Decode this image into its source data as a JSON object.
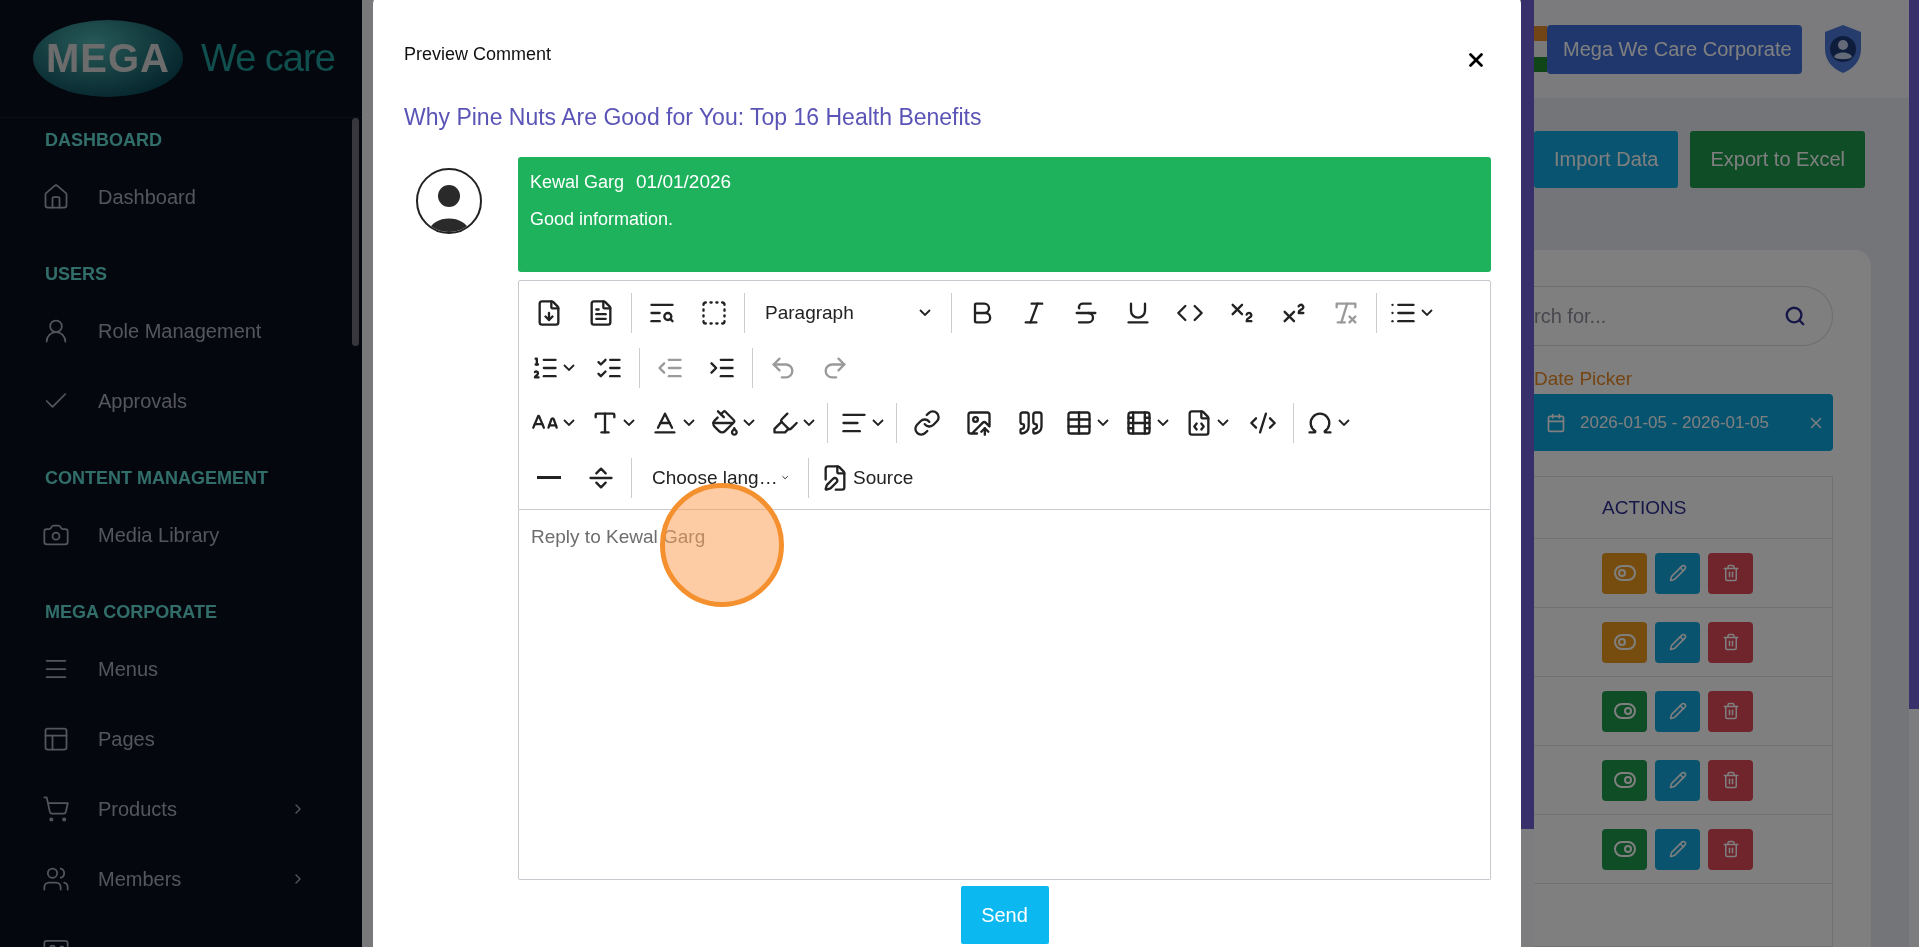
{
  "sidebar": {
    "logo": {
      "badge": "MEGA",
      "text": "We care"
    },
    "sections": [
      {
        "heading": "DASHBOARD",
        "items": [
          {
            "kind": "home",
            "label": "Dashboard",
            "expandable": false
          }
        ]
      },
      {
        "heading": "USERS",
        "items": [
          {
            "kind": "user",
            "label": "Role Management",
            "expandable": false
          },
          {
            "kind": "check",
            "label": "Approvals",
            "expandable": false
          }
        ]
      },
      {
        "heading": "CONTENT MANAGEMENT",
        "items": [
          {
            "kind": "camera",
            "label": "Media Library",
            "expandable": false
          }
        ]
      },
      {
        "heading": "MEGA CORPORATE",
        "items": [
          {
            "kind": "menu",
            "label": "Menus",
            "expandable": false
          },
          {
            "kind": "layout",
            "label": "Pages",
            "expandable": false
          },
          {
            "kind": "cart",
            "label": "Products",
            "expandable": true
          },
          {
            "kind": "users",
            "label": "Members",
            "expandable": true
          },
          {
            "kind": "card",
            "expandable": false
          }
        ]
      }
    ]
  },
  "header": {
    "company": "Mega We Care Corporate"
  },
  "page_buttons": [
    {
      "kind": "import",
      "label": "Import Data"
    },
    {
      "kind": "export",
      "label": "Export to Excel"
    }
  ],
  "search": {
    "placeholder": "rch for..."
  },
  "date_filter": {
    "label": "Date Picker",
    "range": "2026-01-05 - 2026-01-05"
  },
  "table": {
    "columns": [
      "ACTIONS"
    ],
    "rows": [
      {
        "active": false
      },
      {
        "active": false
      },
      {
        "active": true
      },
      {
        "active": true
      },
      {
        "active": true
      }
    ]
  },
  "modal": {
    "title": "Preview Comment",
    "post_title": "Why Pine Nuts Are Good for You: Top 16 Health Benefits",
    "comment": {
      "author": "Kewal Garg",
      "date": "01/01/2026",
      "text": "Good information."
    },
    "editor": {
      "rows": [
        {
          "items": [
            {
              "kind": "pdf",
              "disabled": false,
              "caret": false
            },
            {
              "kind": "word",
              "disabled": false,
              "caret": false
            },
            {
              "kind": "separator"
            },
            {
              "kind": "find",
              "disabled": false,
              "caret": false
            },
            {
              "kind": "selectall",
              "disabled": false,
              "caret": false
            },
            {
              "kind": "separator"
            },
            {
              "kind": "heading",
              "label": "Paragraph",
              "disabled": false,
              "caret": true
            },
            {
              "kind": "separator"
            },
            {
              "kind": "bold",
              "disabled": false,
              "caret": false
            },
            {
              "kind": "italic",
              "disabled": false,
              "caret": false
            },
            {
              "kind": "strike",
              "disabled": false,
              "caret": false
            },
            {
              "kind": "underline",
              "disabled": false,
              "caret": false
            },
            {
              "kind": "code",
              "disabled": false,
              "caret": false
            },
            {
              "kind": "subscript",
              "disabled": false,
              "caret": false
            },
            {
              "kind": "superscript",
              "disabled": false,
              "caret": false
            },
            {
              "kind": "removeformat",
              "disabled": true,
              "caret": false
            },
            {
              "kind": "separator"
            },
            {
              "kind": "bulleted",
              "disabled": false,
              "caret": true
            }
          ]
        },
        {
          "items": [
            {
              "kind": "numbered",
              "disabled": false,
              "caret": true
            },
            {
              "kind": "todo",
              "disabled": false,
              "caret": false
            },
            {
              "kind": "separator"
            },
            {
              "kind": "outdent",
              "disabled": true,
              "caret": false
            },
            {
              "kind": "indent",
              "disabled": false,
              "caret": false
            },
            {
              "kind": "separator"
            },
            {
              "kind": "undo",
              "disabled": true,
              "caret": false
            },
            {
              "kind": "redo",
              "disabled": true,
              "caret": false
            }
          ]
        },
        {
          "items": [
            {
              "kind": "fontsize",
              "disabled": false,
              "caret": true
            },
            {
              "kind": "fontfamily",
              "disabled": false,
              "caret": true
            },
            {
              "kind": "fontcolor",
              "disabled": false,
              "caret": true
            },
            {
              "kind": "bgcolor",
              "disabled": false,
              "caret": true
            },
            {
              "kind": "highlight",
              "disabled": false,
              "caret": true
            },
            {
              "kind": "separator"
            },
            {
              "kind": "align",
              "disabled": false,
              "caret": true
            },
            {
              "kind": "separator"
            },
            {
              "kind": "link",
              "disabled": false,
              "caret": false
            },
            {
              "kind": "image",
              "disabled": false,
              "caret": false
            },
            {
              "kind": "quote",
              "disabled": false,
              "caret": false
            },
            {
              "kind": "table",
              "disabled": false,
              "caret": true
            },
            {
              "kind": "media",
              "disabled": false,
              "caret": true
            },
            {
              "kind": "snippet",
              "disabled": false,
              "caret": true
            },
            {
              "kind": "html",
              "disabled": false,
              "caret": false
            },
            {
              "kind": "separator"
            },
            {
              "kind": "special",
              "disabled": false,
              "caret": true
            }
          ]
        },
        {
          "items": [
            {
              "kind": "hr",
              "disabled": false,
              "caret": false
            },
            {
              "kind": "pagebreak",
              "disabled": false,
              "caret": false
            },
            {
              "kind": "separator"
            },
            {
              "kind": "language",
              "label": "Choose lang…",
              "disabled": false,
              "caret": true
            },
            {
              "kind": "separator"
            },
            {
              "kind": "source",
              "label": "Source",
              "disabled": false,
              "caret": false
            }
          ]
        }
      ],
      "placeholder": "Reply to Kewal Garg"
    },
    "send": "Send"
  }
}
